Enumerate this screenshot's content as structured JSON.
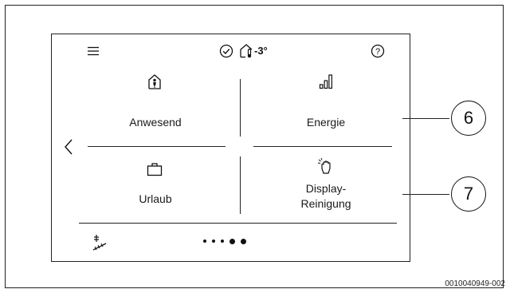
{
  "status_bar": {
    "menu_icon": "hamburger-menu-icon",
    "check_icon": "check-circle-icon",
    "house_icon": "house-thermometer-icon",
    "outdoor_temperature": "-3°",
    "help_icon": "question-circle-icon"
  },
  "tiles": {
    "anwesend": {
      "label": "Anwesend",
      "icon": "house-person-icon"
    },
    "energie": {
      "label": "Energie",
      "icon": "bar-chart-icon"
    },
    "urlaub": {
      "label": "Urlaub",
      "icon": "suitcase-icon"
    },
    "display_reinigung": {
      "label_line1": "Display-",
      "label_line2": "Reinigung",
      "icon": "hand-touch-icon"
    }
  },
  "navigation": {
    "back_icon": "chevron-left-icon",
    "page_count": 5,
    "active_page": 5
  },
  "footer": {
    "install_icon": "installer-icon"
  },
  "callouts": [
    {
      "number": "6",
      "target": "Energie"
    },
    {
      "number": "7",
      "target": "Display-Reinigung"
    }
  ],
  "document_id": "0010040949-002"
}
